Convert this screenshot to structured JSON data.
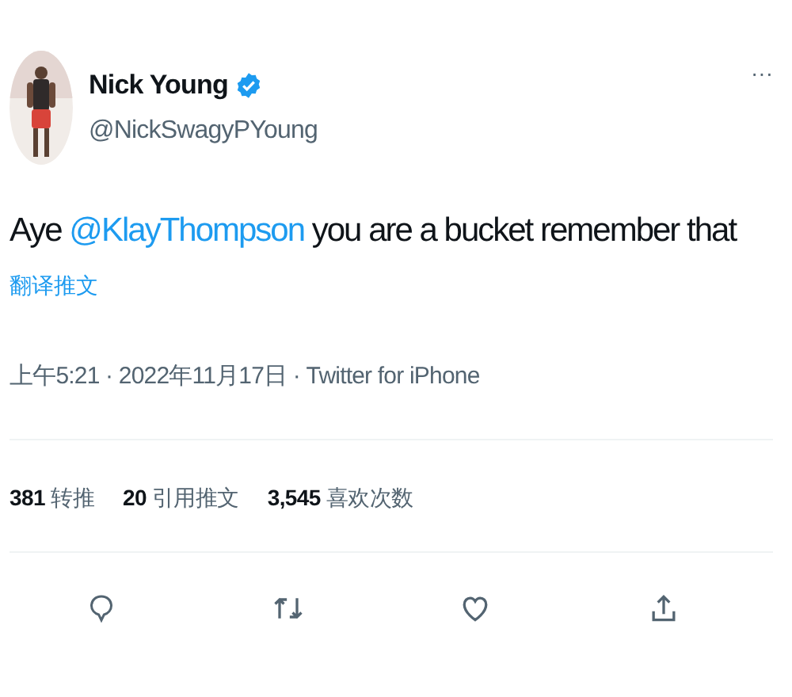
{
  "author": {
    "name": "Nick Young",
    "verified": true,
    "handle": "@NickSwagyPYoung"
  },
  "more": "···",
  "tweet": [
    {
      "kind": "text",
      "text": "Aye "
    },
    {
      "kind": "mention",
      "text": "@KlayThompson"
    },
    {
      "kind": "text",
      "text": " you are a bucket remember that"
    }
  ],
  "translate": "翻译推文",
  "meta": "上午5:21 · 2022年11月17日 · Twitter for iPhone",
  "stats": [
    {
      "count": "381",
      "label": "转推"
    },
    {
      "count": "20",
      "label": "引用推文"
    },
    {
      "count": "3,545",
      "label": "喜欢次数"
    }
  ],
  "actions": [
    {
      "kind": "reply"
    },
    {
      "kind": "retweet"
    },
    {
      "kind": "like"
    },
    {
      "kind": "share"
    }
  ]
}
